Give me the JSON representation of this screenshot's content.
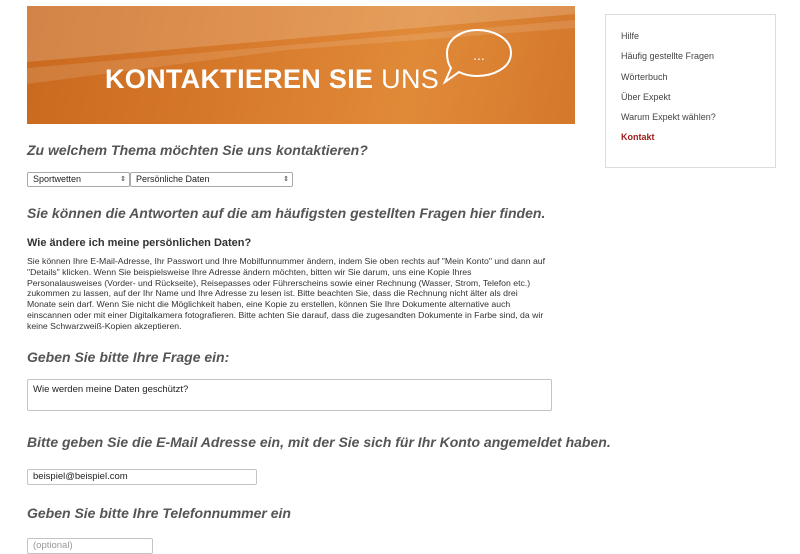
{
  "banner": {
    "title_bold": "KONTAKTIEREN SIE",
    "title_light": "UNS",
    "bubble_text": "..."
  },
  "topic": {
    "heading": "Zu welchem Thema möchten Sie uns kontaktieren?",
    "select1_value": "Sportwetten",
    "select2_value": "Persönliche Daten"
  },
  "faq": {
    "heading": "Sie können die Antworten auf die am häufigsten gestellten Fragen hier finden.",
    "question": "Wie ändere ich meine persönlichen Daten?",
    "answer_lines": [
      "Sie können Ihre E-Mail-Adresse, Ihr Passwort und Ihre Mobilfunnummer ändern, indem Sie oben rechts auf \"Mein Konto\" und dann auf",
      "\"Details\" klicken. Wenn Sie beispielsweise Ihre Adresse ändern möchten, bitten wir Sie darum, uns eine Kopie Ihres",
      "Personalausweises (Vorder- und Rückseite), Reisepasses oder Führerscheins sowie einer Rechnung (Wasser, Strom, Telefon etc.)",
      "zukommen zu lassen, auf der Ihr Name und Ihre Adresse zu lesen ist. Bitte beachten Sie, dass die Rechnung nicht älter als drei",
      "Monate sein darf. Wenn Sie nicht die Möglichkeit haben, eine Kopie zu erstellen, können Sie Ihre Dokumente alternative auch",
      "einscannen oder mit einer Digitalkamera fotografieren. Bitte achten Sie darauf, dass die zugesandten Dokumente in Farbe sind, da wir",
      "keine Schwarzweiß-Kopien akzeptieren."
    ]
  },
  "form": {
    "question_heading": "Geben Sie bitte Ihre Frage ein:",
    "question_value": "Wie werden meine Daten geschützt?",
    "email_heading": "Bitte geben Sie die E-Mail Adresse ein, mit der Sie sich für Ihr Konto angemeldet haben.",
    "email_value": "beispiel@beispiel.com",
    "phone_heading": "Geben Sie bitte Ihre Telefonnummer ein",
    "phone_placeholder": "(optional)"
  },
  "sidebar": {
    "items": [
      {
        "label": "Hilfe"
      },
      {
        "label": "Häufig gestellte Fragen"
      },
      {
        "label": "Wörterbuch"
      },
      {
        "label": "Über Expekt"
      },
      {
        "label": "Warum Expekt wählen?"
      },
      {
        "label": "Kontakt"
      }
    ]
  },
  "colors": {
    "banner_orange": "#d6782a",
    "active_link": "#9c1b1b"
  }
}
